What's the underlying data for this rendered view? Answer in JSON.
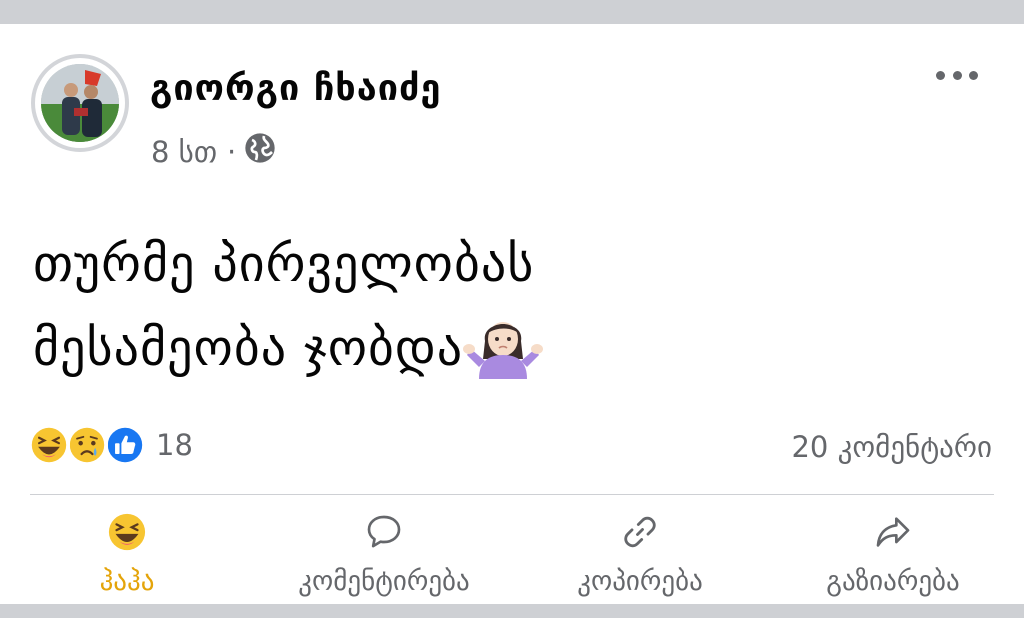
{
  "post": {
    "author": "გიორგი ჩხაიძე",
    "time": "8 სთ",
    "separator": "·",
    "privacy_icon": "globe-icon",
    "more_icon": "more-horizontal-icon",
    "text_line1": "თურმე პირველობას",
    "text_line2": "მესამეობა ჯობდა",
    "text_emoji": "woman-shrugging-emoji"
  },
  "reactions": {
    "icons": [
      "haha-emoji",
      "sad-emoji",
      "like-icon"
    ],
    "count": "18",
    "comments": "20 კომენტარი"
  },
  "actions": [
    {
      "label": "ჰაჰა",
      "icon": "haha-emoji",
      "active": true
    },
    {
      "label": "კომენტირება",
      "icon": "comment-icon",
      "active": false
    },
    {
      "label": "კოპირება",
      "icon": "link-icon",
      "active": false
    },
    {
      "label": "გაზიარება",
      "icon": "share-icon",
      "active": false
    }
  ],
  "colors": {
    "haha_active": "#e4a40a",
    "secondary_text": "#65676b",
    "like_blue": "#1877f2",
    "emoji_yellow": "#f7c531"
  }
}
